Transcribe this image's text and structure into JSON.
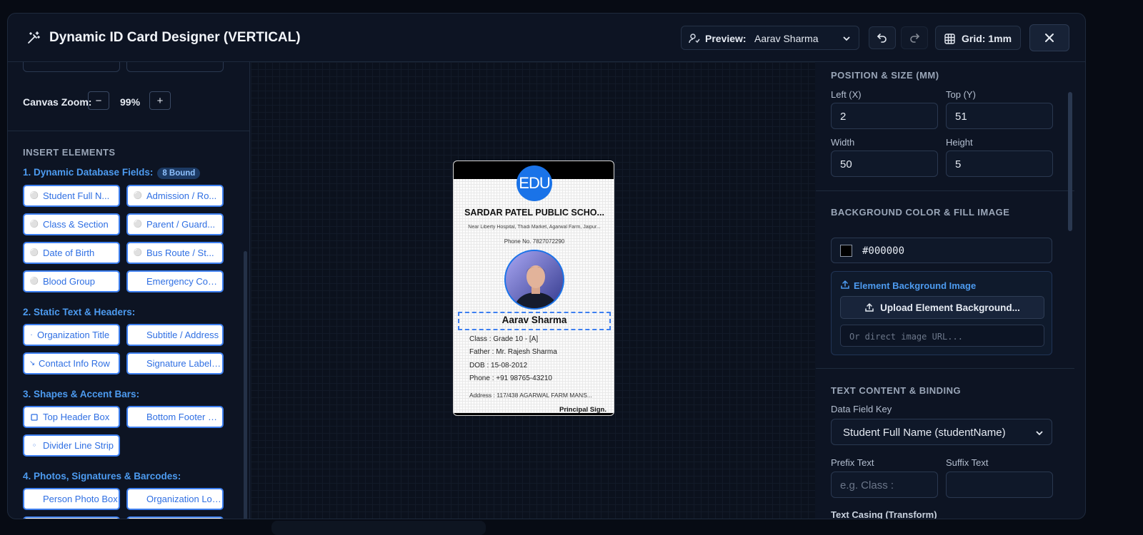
{
  "header": {
    "title": "Dynamic ID Card Designer (VERTICAL)",
    "preview_label": "Preview:",
    "preview_value": "Aarav Sharma",
    "grid_label": "Grid: 1mm",
    "icons": [
      "magic-wand-icon",
      "user-preview-icon",
      "chevron-down-icon",
      "undo-icon",
      "redo-icon",
      "grid-icon",
      "close-icon"
    ]
  },
  "left": {
    "zoom_label": "Canvas Zoom:",
    "zoom_minus": "−",
    "zoom_value": "99%",
    "zoom_plus": "+",
    "insert_heading": "INSERT ELEMENTS",
    "group1": {
      "title": "1. Dynamic Database Fields:",
      "badge": "8 Bound",
      "items": [
        "Student Full N...",
        "Admission / Ro...",
        "Class & Section",
        "Parent / Guard...",
        "Date of Birth",
        "Bus Route / St...",
        "Blood Group",
        "Emergency Cont..."
      ]
    },
    "group2": {
      "title": "2. Static Text & Headers:",
      "items": [
        "Organization Title",
        "Subtitle / Address",
        "Contact Info Row",
        "Signature Label (Te"
      ]
    },
    "group3": {
      "title": "3. Shapes & Accent Bars:",
      "items": [
        "Top Header Box",
        "Bottom Footer Bar",
        "Divider Line Strip"
      ]
    },
    "group4": {
      "title": "4. Photos, Signatures & Barcodes:",
      "items": [
        "Person Photo Box",
        "Organization Logo"
      ]
    }
  },
  "card": {
    "logo_text": "EDU",
    "school": "SARDAR PATEL PUBLIC SCHO...",
    "address": "Near Liberty Hospital, Thadi Market, Agarwal Farm, Jaipur...",
    "phone": "Phone No. 7827072290",
    "name": "Aarav Sharma",
    "class_line": "Class : Grade 10 - [A]",
    "father_line": "Father : Mr. Rajesh Sharma",
    "dob_line": "DOB : 15-08-2012",
    "phone_line": "Phone : +91 98765-43210",
    "address_line": "Address : 117/438 AGARWAL FARM MANS...",
    "sign_label": "Principal Sign."
  },
  "right": {
    "pos_heading": "POSITION & SIZE (MM)",
    "left_label": "Left (X)",
    "left_value": "2",
    "top_label": "Top (Y)",
    "top_value": "51",
    "width_label": "Width",
    "width_value": "50",
    "height_label": "Height",
    "height_value": "5",
    "bg_heading": "BACKGROUND COLOR & FILL IMAGE",
    "bg_color": "#000000",
    "bg_image_heading": "Element Background Image",
    "upload_label": "Upload Element Background...",
    "url_placeholder": "Or direct image URL...",
    "text_heading": "TEXT CONTENT & BINDING",
    "data_key_label": "Data Field Key",
    "data_key_value": "Student Full Name (studentName)",
    "prefix_label": "Prefix Text",
    "prefix_placeholder": "e.g. Class :",
    "suffix_label": "Suffix Text",
    "suffix_value": "",
    "casing_label": "Text Casing (Transform)"
  }
}
